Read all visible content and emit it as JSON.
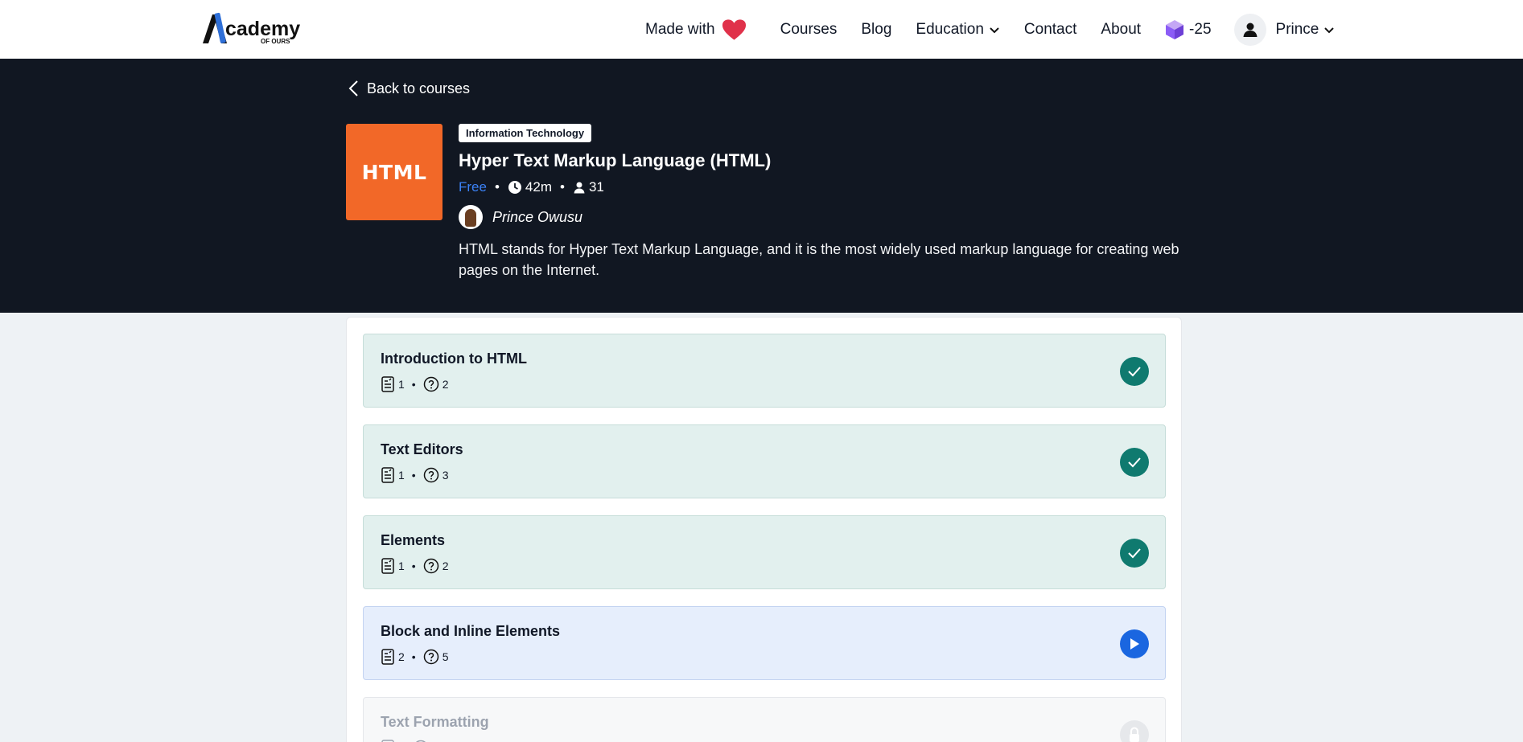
{
  "nav": {
    "logo_main": "cademy",
    "logo_letter": "A",
    "logo_sub": "OF OURS",
    "made_with": "Made with",
    "courses": "Courses",
    "blog": "Blog",
    "education": "Education",
    "contact": "Contact",
    "about": "About",
    "gems": "-25",
    "user_name": "Prince"
  },
  "hero": {
    "back_label": "Back to courses",
    "image_text": "HTML",
    "category": "Information Technology",
    "title": "Hyper Text Markup Language (HTML)",
    "price": "Free",
    "duration": "42m",
    "students": "31",
    "author": "Prince Owusu",
    "description": "HTML stands for Hyper Text Markup Language, and it is the most widely used markup language for creating web pages on the Internet."
  },
  "lessons": [
    {
      "title": "Introduction to HTML",
      "notes": "1",
      "quizzes": "2",
      "status": "completed"
    },
    {
      "title": "Text Editors",
      "notes": "1",
      "quizzes": "3",
      "status": "completed"
    },
    {
      "title": "Elements",
      "notes": "1",
      "quizzes": "2",
      "status": "completed"
    },
    {
      "title": "Block and Inline Elements",
      "notes": "2",
      "quizzes": "5",
      "status": "in-progress"
    },
    {
      "title": "Text Formatting",
      "notes": "",
      "quizzes": "",
      "status": "locked"
    }
  ],
  "colors": {
    "hero_bg": "#111722",
    "course_image_bg": "#f26828",
    "completed": "#0f7a6f",
    "active": "#1a66e0",
    "free": "#3b82f6",
    "heart": "#e0314a"
  }
}
